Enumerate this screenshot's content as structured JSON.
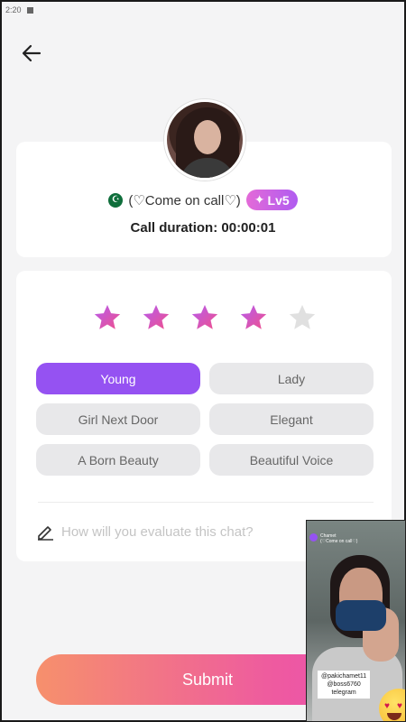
{
  "status_bar": {
    "time": "2:20"
  },
  "profile": {
    "name": "(♡Come on call♡)",
    "level": "Lv5",
    "call_duration": "Call duration: 00:00:01"
  },
  "rating": {
    "value": 4,
    "max": 5
  },
  "tags": [
    {
      "label": "Young",
      "selected": true
    },
    {
      "label": "Lady",
      "selected": false
    },
    {
      "label": "Girl Next Door",
      "selected": false
    },
    {
      "label": "Elegant",
      "selected": false
    },
    {
      "label": "A Born Beauty",
      "selected": false
    },
    {
      "label": "Beautiful Voice",
      "selected": false
    }
  ],
  "comment": {
    "placeholder": "How will you evaluate this chat?",
    "value": ""
  },
  "submit_label": "Submit",
  "overlay": {
    "app_name": "Chamet",
    "subtitle": "(♡Come on call♡)",
    "handles": [
      "@pakichamet11",
      "@boss6760",
      "telegram"
    ]
  },
  "colors": {
    "accent": "#9552f2",
    "star_filled": "#f0508c",
    "star_empty": "#e0e0e0"
  }
}
